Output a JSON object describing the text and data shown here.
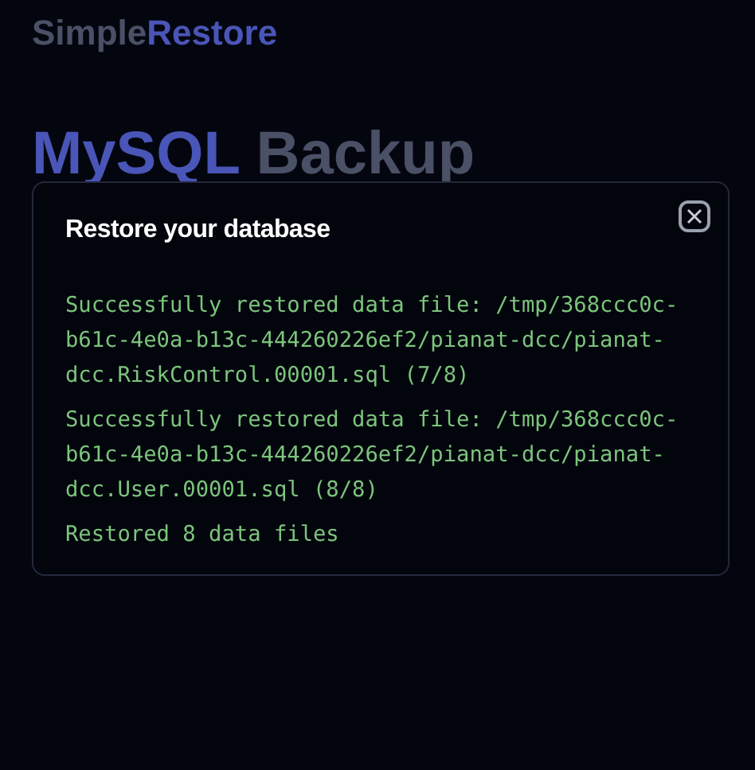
{
  "background": {
    "logo": {
      "first": "Simple",
      "second": "Restore"
    },
    "heading": {
      "first": "MySQL",
      "second": "Backup"
    }
  },
  "dialog": {
    "title": "Restore your database",
    "log": [
      {
        "text": "Successfully restored data file: /tmp/368ccc0c-b61c-4e0a-b13c-444260226ef2/pianat-dcc/pianat-dcc.RiskControl.00001.sql (7/8)"
      },
      {
        "text": "Successfully restored data file: /tmp/368ccc0c-b61c-4e0a-b13c-444260226ef2/pianat-dcc/pianat-dcc.User.00001.sql (8/8)"
      },
      {
        "text": "Restored 8 data files"
      }
    ]
  }
}
